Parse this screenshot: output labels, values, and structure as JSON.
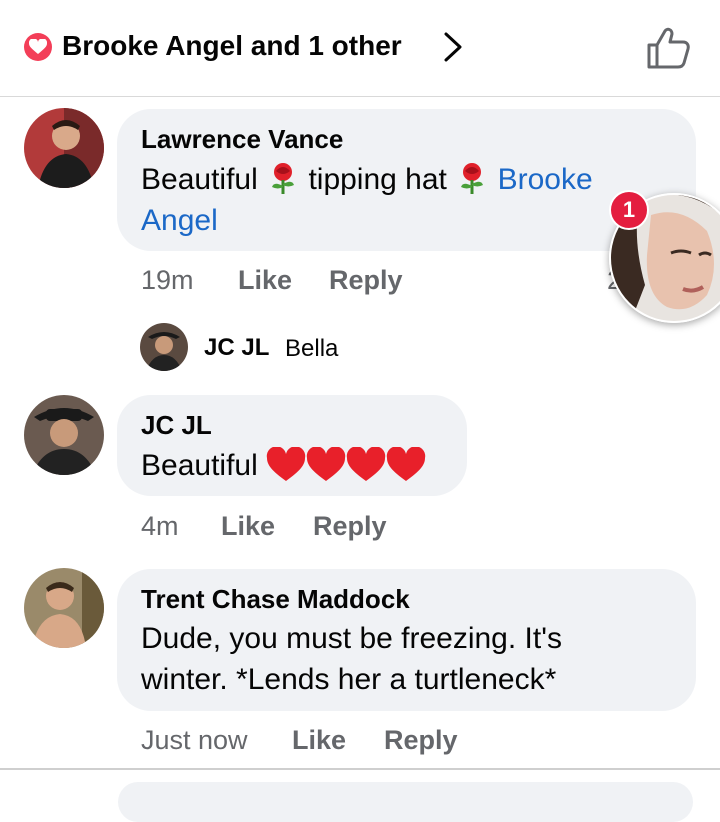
{
  "header": {
    "title": "Brooke Angel and 1 other",
    "heart_color": "#f33e58",
    "icons": [
      "heart-reaction-icon",
      "chevron-right-icon",
      "thumbs-up-icon"
    ]
  },
  "comments": [
    {
      "author": "Lawrence Vance",
      "text_part1": "Beautiful",
      "text_part2": "tipping hat",
      "mention_line1": "Brooke",
      "mention_line2": "Angel",
      "time": "19m",
      "like": "Like",
      "reply": "Reply",
      "reactions_count": "2"
    },
    {
      "author": "JC JL",
      "text": "Bella"
    },
    {
      "author": "JC JL",
      "text": "Beautiful",
      "time": "4m",
      "like": "Like",
      "reply": "Reply"
    },
    {
      "author": "Trent Chase Maddock",
      "text_line1": "Dude, you must be freezing. It's",
      "text_line2": "winter. *Lends her a turtleneck*",
      "time": "Just now",
      "like": "Like",
      "reply": "Reply"
    }
  ],
  "chathead": {
    "badge": "1"
  },
  "colors": {
    "link": "#1b68c7",
    "bubble": "#f0f2f5",
    "meta": "#65676b",
    "badge": "#e41e3f"
  }
}
